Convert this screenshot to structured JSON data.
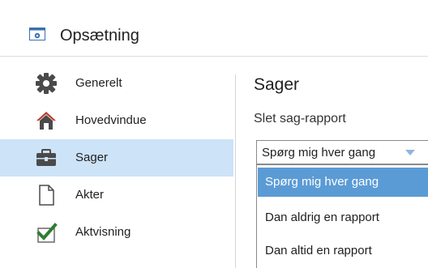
{
  "window": {
    "title": "Opsætning",
    "title_icon": "settings-window-icon"
  },
  "sidebar": {
    "items": [
      {
        "label": "Generelt",
        "icon": "gear-icon",
        "active": false
      },
      {
        "label": "Hovedvindue",
        "icon": "house-icon",
        "active": false
      },
      {
        "label": "Sager",
        "icon": "case-icon",
        "active": true
      },
      {
        "label": "Akter",
        "icon": "document-icon",
        "active": false
      },
      {
        "label": "Aktvisning",
        "icon": "checkmark-document-icon",
        "active": false
      }
    ]
  },
  "main": {
    "section_title": "Sager",
    "field_label": "Slet sag-rapport",
    "select": {
      "value": "Spørg mig hver gang",
      "options": [
        {
          "label": "Spørg mig hver gang",
          "highlighted": true
        },
        {
          "label": "Dan aldrig en rapport",
          "highlighted": false
        },
        {
          "label": "Dan altid en rapport",
          "highlighted": false
        }
      ]
    }
  },
  "colors": {
    "active_item_bg": "#cde3f7",
    "option_highlight_bg": "#5b9bd5",
    "accent_icon": "#2e7d32"
  }
}
